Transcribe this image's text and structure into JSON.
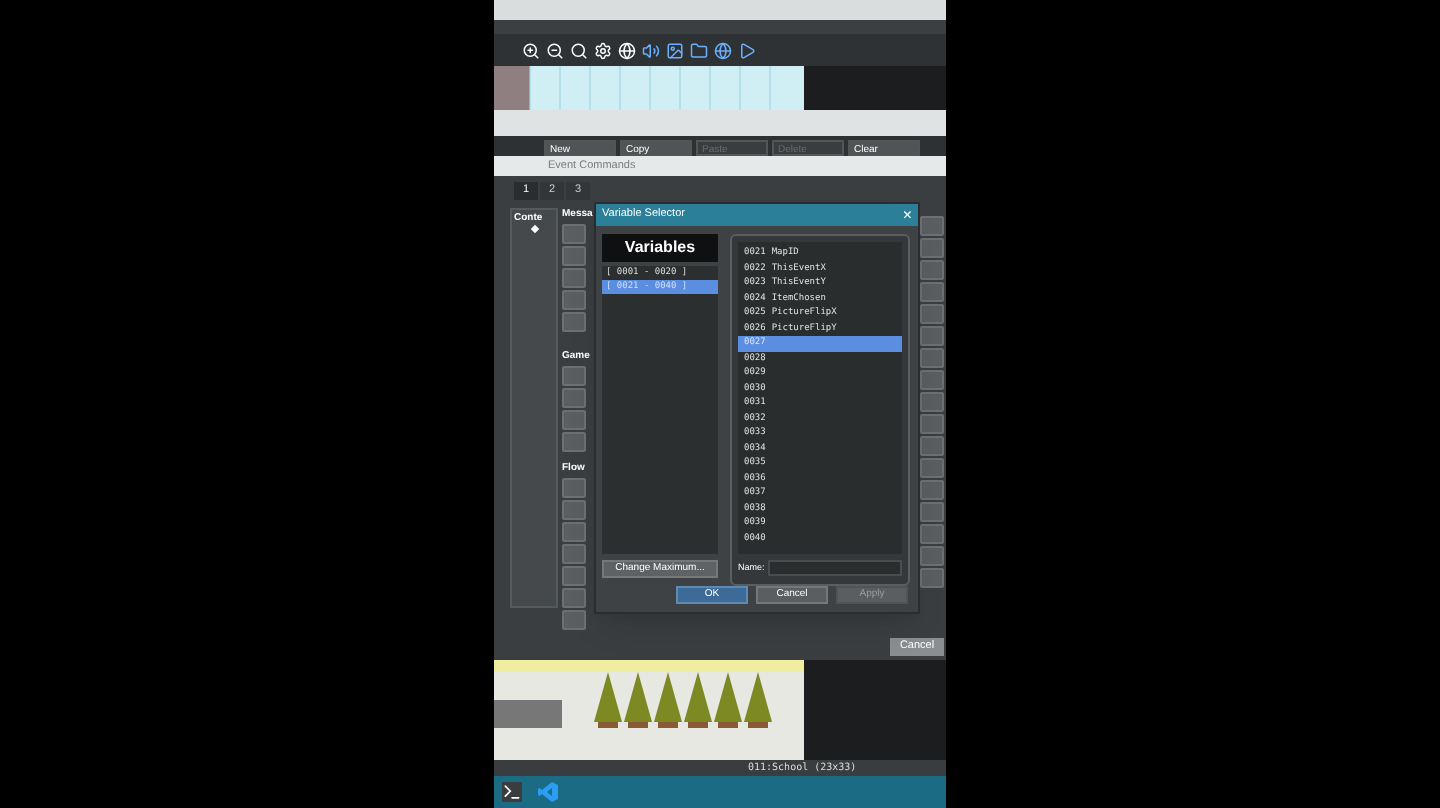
{
  "event_buttons": [
    {
      "label": "New",
      "disabled": false
    },
    {
      "label": "Copy",
      "disabled": false
    },
    {
      "label": "Paste",
      "disabled": true
    },
    {
      "label": "Delete",
      "disabled": true
    },
    {
      "label": "Clear",
      "disabled": false
    }
  ],
  "event_commands": {
    "title": "Event Commands",
    "tabs": [
      {
        "label": "1",
        "selected": true
      },
      {
        "label": "2",
        "selected": false
      },
      {
        "label": "3",
        "selected": false
      }
    ],
    "contents_label": "Conte",
    "sections": [
      "Messa",
      "Game",
      "Flow"
    ],
    "cancel": "Cancel"
  },
  "dialog": {
    "title": "Variable Selector",
    "close": "×",
    "heading": "Variables",
    "groups": [
      {
        "label": "[ 0001 - 0020 ]",
        "selected": false
      },
      {
        "label": "[ 0021 - 0040 ]",
        "selected": true
      }
    ],
    "variables": [
      {
        "number": "0021",
        "name": "MapID",
        "selected": false
      },
      {
        "number": "0022",
        "name": "ThisEventX",
        "selected": false
      },
      {
        "number": "0023",
        "name": "ThisEventY",
        "selected": false
      },
      {
        "number": "0024",
        "name": "ItemChosen",
        "selected": false
      },
      {
        "number": "0025",
        "name": "PictureFlipX",
        "selected": false
      },
      {
        "number": "0026",
        "name": "PictureFlipY",
        "selected": false
      },
      {
        "number": "0027",
        "selected": true
      },
      {
        "number": "0028",
        "selected": false
      },
      {
        "number": "0029",
        "selected": false
      },
      {
        "number": "0030",
        "selected": false
      },
      {
        "number": "0031",
        "selected": false
      },
      {
        "number": "0032",
        "selected": false
      },
      {
        "number": "0033",
        "selected": false
      },
      {
        "number": "0034",
        "selected": false
      },
      {
        "number": "0035",
        "selected": false
      },
      {
        "number": "0036",
        "selected": false
      },
      {
        "number": "0037",
        "selected": false
      },
      {
        "number": "0038",
        "selected": false
      },
      {
        "number": "0039",
        "selected": false
      },
      {
        "number": "0040",
        "selected": false
      }
    ],
    "change_maximum": "Change Maximum...",
    "name_label": "Name:",
    "buttons": [
      {
        "label": "OK",
        "kind": "primary",
        "disabled": false
      },
      {
        "label": "Cancel",
        "kind": "normal",
        "disabled": false
      },
      {
        "label": "Apply",
        "kind": "normal",
        "disabled": true
      }
    ]
  },
  "status_bar": "011:School (23x33)"
}
